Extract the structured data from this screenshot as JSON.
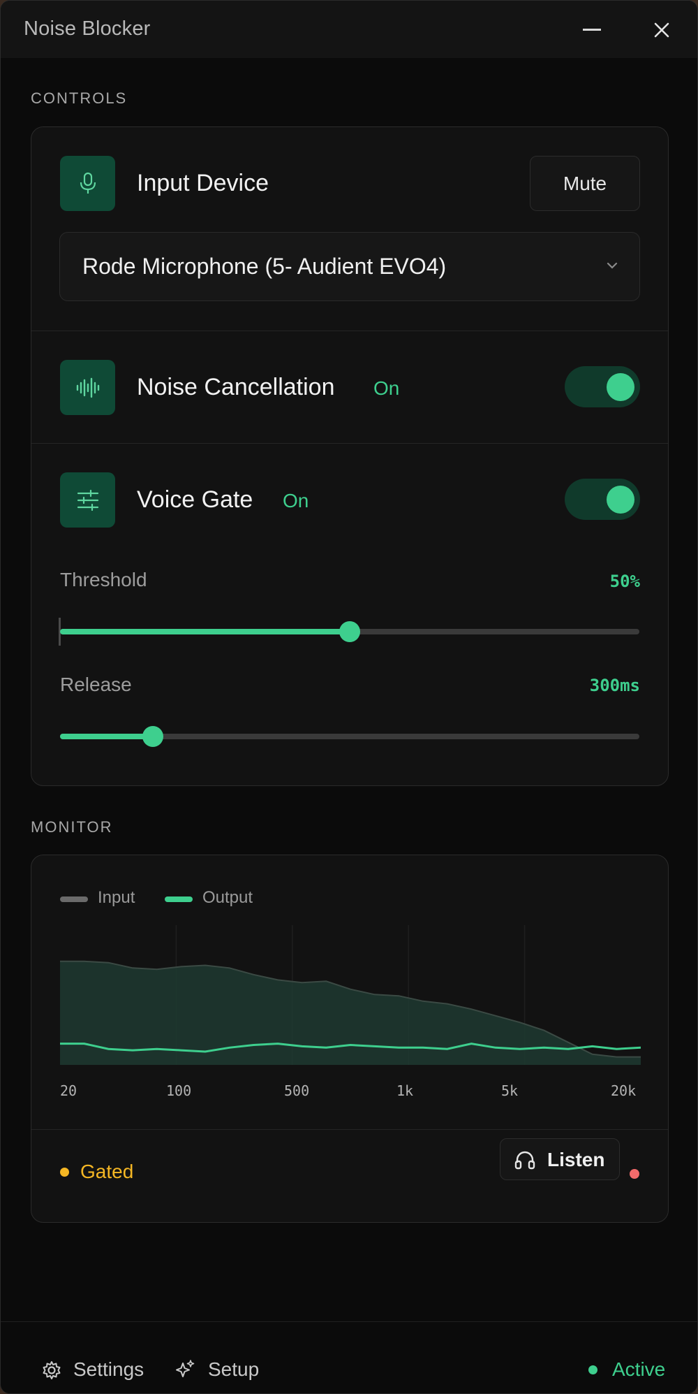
{
  "window": {
    "title": "Noise Blocker",
    "minimize_icon": "minimize-icon",
    "close_icon": "close-icon"
  },
  "controls": {
    "section_label": "CONTROLS",
    "input_device": {
      "title": "Input Device",
      "icon": "microphone-icon",
      "mute_label": "Mute",
      "selected_device": "Rode Microphone (5- Audient EVO4)"
    },
    "noise_cancellation": {
      "title": "Noise Cancellation",
      "icon": "waveform-icon",
      "state": "On",
      "enabled": true
    },
    "voice_gate": {
      "title": "Voice Gate",
      "icon": "sliders-icon",
      "state": "On",
      "enabled": true,
      "threshold": {
        "label": "Threshold",
        "value_text": "50%",
        "fraction": 0.5
      },
      "release": {
        "label": "Release",
        "value_text": "300ms",
        "fraction": 0.16
      }
    }
  },
  "monitor": {
    "section_label": "MONITOR",
    "chart_data": {
      "type": "area",
      "series": [
        {
          "name": "Input",
          "color": "#6b6b6b",
          "values": [
            0.78,
            0.78,
            0.77,
            0.73,
            0.72,
            0.74,
            0.75,
            0.73,
            0.68,
            0.64,
            0.62,
            0.63,
            0.57,
            0.53,
            0.52,
            0.48,
            0.46,
            0.42,
            0.37,
            0.32,
            0.26,
            0.17,
            0.08,
            0.06,
            0.06
          ]
        },
        {
          "name": "Output",
          "color": "#3ecf8e",
          "values": [
            0.16,
            0.16,
            0.12,
            0.11,
            0.12,
            0.11,
            0.1,
            0.13,
            0.15,
            0.16,
            0.14,
            0.13,
            0.15,
            0.14,
            0.13,
            0.13,
            0.12,
            0.16,
            0.13,
            0.12,
            0.13,
            0.12,
            0.14,
            0.12,
            0.13
          ]
        }
      ],
      "x_ticks": [
        "20",
        "100",
        "500",
        "1k",
        "5k",
        "20k"
      ],
      "legend": "top-left",
      "grid": true
    },
    "status": {
      "label": "Gated",
      "color": "#f5b724"
    },
    "listen_label": "Listen",
    "listen_icon": "headphones-icon",
    "record_dot_color": "#f26b6b"
  },
  "footer": {
    "settings_label": "Settings",
    "settings_icon": "gear-icon",
    "setup_label": "Setup",
    "setup_icon": "sparkle-icon",
    "status_label": "Active"
  }
}
